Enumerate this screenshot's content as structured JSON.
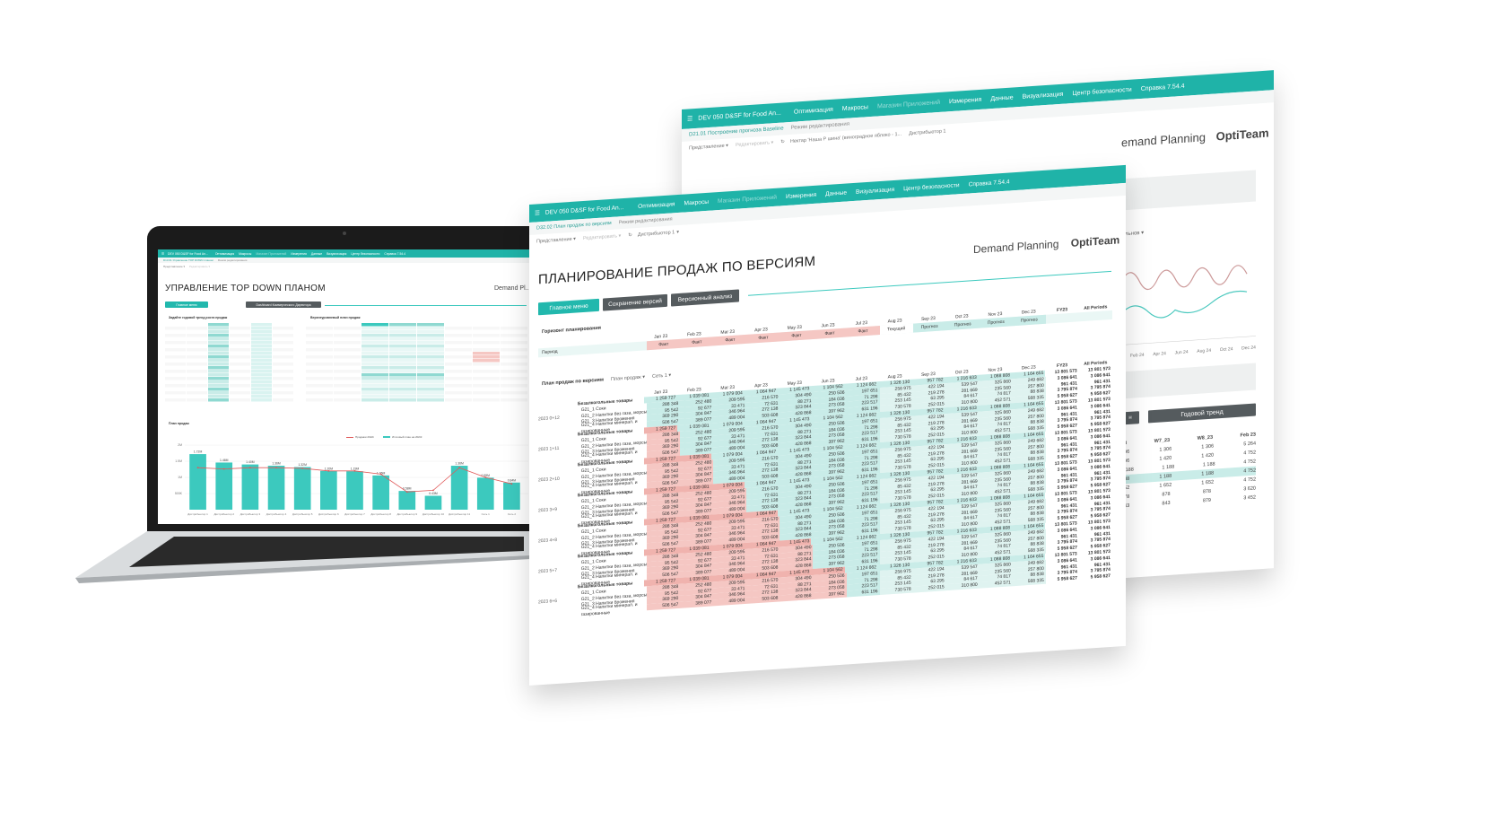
{
  "app": {
    "title": "DEV 050 D&SF for Food An...",
    "menu": [
      "Оптимизация",
      "Макросы",
      "Магазин Приложений",
      "Измерения",
      "Данные",
      "Визуализация",
      "Центр безопасности",
      "Справка 7.54.4"
    ],
    "edit_mode": "Режим редактирования",
    "toolbar": {
      "view": "Представление ▾",
      "redact": "Редактировать ▾"
    },
    "brand_text": "Demand Planning",
    "logo_text": "OptiTeam"
  },
  "back_window": {
    "breadcrumb": "D21.01 Построение прогноза Baseline",
    "filter_sector": "Нектар 'Наша Р шина' (виноградное яблоко - 1...",
    "filter_distributor": "Дистрибьютор 1",
    "brand_text": "emand Planning",
    "logo_text": "OptiTeam",
    "chart_x_labels": [
      "Feb 24",
      "Apr 24",
      "Jun 24",
      "Aug 24",
      "Oct 24",
      "Dec 24"
    ],
    "button_trend": "Годовой тренд",
    "button_left": "н",
    "dropdown": "льнов",
    "table_headers": [
      "W7_23",
      "W8_23",
      "Feb 23"
    ],
    "table_rows": [
      [
        "306",
        "1 306",
        "1 306",
        "1 306"
      ],
      [
        "206",
        "1 420",
        "1 420",
        "1 420"
      ],
      [
        "1 188",
        "1 188",
        "1 188",
        "1 188"
      ],
      [
        "188",
        "1 188",
        "1 188",
        "1 188"
      ],
      [
        "652",
        "1 652",
        "1 652",
        "1 652"
      ],
      [
        "878",
        "878",
        "878",
        "878"
      ],
      [
        "343",
        "843",
        "879",
        "879"
      ]
    ],
    "table_right": [
      "5 264",
      "4 752",
      "4 752",
      "4 752",
      "4 752",
      "3 620",
      "3 452"
    ],
    "year_label": "23"
  },
  "front_window": {
    "breadcrumb": "D32.02 План продаж по версиям",
    "distributor": "Дистрибьютор 1",
    "page_title": "ПЛАНИРОВАНИЕ ПРОДАЖ ПО ВЕРСИЯМ",
    "buttons": {
      "main_menu": "Главное меню",
      "save_version": "Сохранение версий",
      "version_analysis": "Версионный анализ"
    },
    "horizon_label": "Горизонт планирования",
    "months": [
      "Jan 23",
      "Feb 23",
      "Mar 23",
      "Apr 23",
      "May 23",
      "Jun 23",
      "Jul 23",
      "Aug 23",
      "Sep 23",
      "Oct 23",
      "Nov 23",
      "Dec 23",
      "FY23",
      "All Periods"
    ],
    "period_label": "Период",
    "period_values": [
      "Факт",
      "Факт",
      "Факт",
      "Факт",
      "Факт",
      "Факт",
      "Факт",
      "Текущий",
      "Прогноз",
      "Прогноз",
      "Прогноз",
      "Прогноз",
      "",
      ""
    ],
    "plan_label": "План продаж по версиям",
    "plan_filter1": "План продаж ▾",
    "plan_filter2": "Сеть 1 ▾",
    "groups": [
      "2023 0+12",
      "2023 1+11",
      "2023 2+10",
      "2023 3+9",
      "2023 4+8",
      "2023 5+7",
      "2023 6+6"
    ],
    "row_labels": [
      "Безалкогольные товары",
      "G21_1 Соки",
      "G21_2 Напитки без газа, морсы",
      "G21_3 Напитки брожения",
      "G21_4 Напитки минерал. и газированные"
    ],
    "rows": [
      [
        "1 259 727",
        "1 039 081",
        "1 079 004",
        "1 064 947",
        "1 145 473",
        "1 104 562",
        "1 124 662",
        "1 326 130",
        "957 782",
        "1 216 633",
        "1 088 808",
        "1 164 655",
        "13 801 573",
        "13 801 573"
      ],
      [
        "288 348",
        "252 480",
        "209 595",
        "216 570",
        "304 490",
        "250 506",
        "197 651",
        "256 975",
        "422 194",
        "539 547",
        "325 860",
        "249 682",
        "3 086 641",
        "3 086 641"
      ],
      [
        "95 542",
        "92 677",
        "33 471",
        "72 631",
        "88 271",
        "184 036",
        "71 298",
        "85 432",
        "219 278",
        "281 669",
        "235 560",
        "257 800",
        "961 431",
        "961 431"
      ],
      [
        "369 290",
        "304 847",
        "346 964",
        "272 138",
        "323 844",
        "273 058",
        "223 517",
        "253 145",
        "63 295",
        "84 617",
        "74 817",
        "88 838",
        "3 795 874",
        "3 795 874"
      ],
      [
        "506 547",
        "389 077",
        "489 004",
        "503 608",
        "428 868",
        "397 962",
        "631 196",
        "730 578",
        "252 015",
        "310 800",
        "452 571",
        "568 335",
        "5 958 627",
        "5 958 627"
      ]
    ],
    "row_labels_all_groups": 35
  },
  "laptop": {
    "page_title": "УПРАВЛЕНИЕ TOP DOWN ПЛАНОМ",
    "brand_text": "Demand Pl...",
    "breadcrumb": "D13.01 Управление TOP DOWN планом",
    "buttons": {
      "main_menu": "Главное меню",
      "dashboard": "Dashboard Коммерческого Директора"
    },
    "panel1_title": "Задайте годовой тренд роста продаж",
    "panel2_title": "Верхнеуровневый план продаж",
    "chart_title": "План продаж",
    "legend": [
      "Продажи 2022г",
      "Итоговый план на 2023г"
    ],
    "y_ticks": [
      "2M",
      "1.5M",
      "1M",
      "500K"
    ],
    "bar_labels": [
      "1.72M",
      "1.46M",
      "1.40M",
      "1.36M",
      "1.32M",
      "1.20M",
      "1.19M",
      "1.06M",
      "0.58M",
      "0.43M",
      "1.36M",
      "0.99M",
      "0.84M"
    ],
    "x_labels": [
      "Дистрибьютор 1",
      "Дистрибьютор 2",
      "Дистрибьютор 3",
      "Дистрибьютор 4",
      "Дистрибьютор 5",
      "Дистрибьютор 6",
      "Дистрибьютор 7",
      "Дистрибьютор 8",
      "Дистрибьютор 9",
      "Дистрибьютор 10",
      "Дистрибьютор 11",
      "Сеть 1",
      "Сеть 2"
    ]
  },
  "chart_data": {
    "type": "bar",
    "title": "План продаж",
    "categories": [
      "Дистрибьютор 1",
      "Дистрибьютор 2",
      "Дистрибьютор 3",
      "Дистрибьютор 4",
      "Дистрибьютор 5",
      "Дистрибьютор 6",
      "Дистрибьютор 7",
      "Дистрибьютор 8",
      "Дистрибьютор 9",
      "Дистрибьютор 10",
      "Дистрибьютор 11",
      "Сеть 1",
      "Сеть 2"
    ],
    "series": [
      {
        "name": "Итоговый план на 2023г",
        "values": [
          1.72,
          1.46,
          1.4,
          1.36,
          1.32,
          1.2,
          1.19,
          1.06,
          0.58,
          0.43,
          1.36,
          0.99,
          0.84
        ]
      },
      {
        "name": "Продажи 2022г",
        "values": [
          1.3,
          1.26,
          1.3,
          1.3,
          1.28,
          1.2,
          1.2,
          1.1,
          0.55,
          0.6,
          1.3,
          1.0,
          0.8
        ]
      }
    ],
    "ylim": [
      0,
      2
    ],
    "colors": {
      "bars": "#3cc9be",
      "line": "#e05a5a"
    }
  }
}
